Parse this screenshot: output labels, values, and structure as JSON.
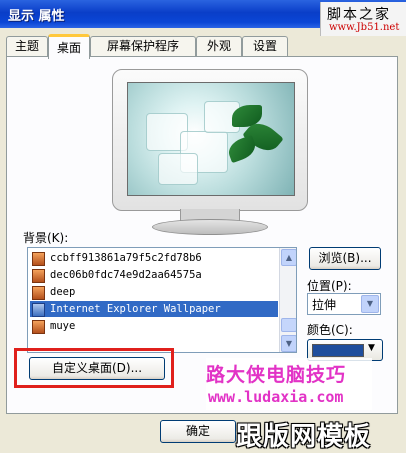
{
  "window": {
    "title": "显示 属性"
  },
  "watermark_top": {
    "chars": "脚本之家",
    "url": "www.Jb51.net"
  },
  "tabs": [
    {
      "label": "主题",
      "active": false
    },
    {
      "label": "桌面",
      "active": true
    },
    {
      "label": "屏幕保护程序",
      "active": false
    },
    {
      "label": "外观",
      "active": false
    },
    {
      "label": "设置",
      "active": false
    }
  ],
  "background": {
    "label": "背景(K):",
    "items": [
      {
        "name": "ccbff913861a79f5c2fd78b6",
        "selected": false
      },
      {
        "name": "dec06b0fdc74e9d2aa64575a",
        "selected": false
      },
      {
        "name": "deep",
        "selected": false
      },
      {
        "name": "Internet Explorer Wallpaper",
        "selected": true
      },
      {
        "name": "muye",
        "selected": false
      }
    ]
  },
  "browse_button": "浏览(B)...",
  "position": {
    "label": "位置(P):",
    "value": "拉伸"
  },
  "color": {
    "label": "颜色(C):",
    "value": "#1f4e9c"
  },
  "customize_button": "自定义桌面(D)...",
  "ok_button": "确定",
  "promo": {
    "title": "路大侠电脑技巧",
    "url": "www.ludaxia.com"
  },
  "brand_watermark": "跟版网模板",
  "colors": {
    "titlebar": "#0a3ec8",
    "selection": "#316ac5",
    "highlight_box": "#e0201c",
    "promo_text": "#e233c6"
  }
}
